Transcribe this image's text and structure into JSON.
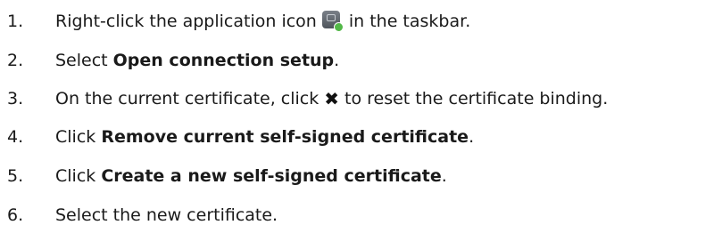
{
  "steps": [
    {
      "number": "1.",
      "text_before": "Right-click the application icon",
      "icon": "application-tray-icon",
      "text_after": "in the taskbar."
    },
    {
      "number": "2.",
      "text_before": "Select ",
      "bold": "Open connection setup",
      "text_after": "."
    },
    {
      "number": "3.",
      "text_before": "On the current certificate, click",
      "icon": "x-icon",
      "icon_glyph": "✖",
      "text_after": "to reset the certificate binding."
    },
    {
      "number": "4.",
      "text_before": "Click ",
      "bold": "Remove current self-signed certificate",
      "text_after": "."
    },
    {
      "number": "5.",
      "text_before": "Click ",
      "bold": "Create a new self-signed certificate",
      "text_after": "."
    },
    {
      "number": "6.",
      "text_before": "Select the new certificate."
    }
  ],
  "colors": {
    "text": "#1a1a1a",
    "icon_tile": "#5f656d",
    "icon_status": "#52b848"
  }
}
